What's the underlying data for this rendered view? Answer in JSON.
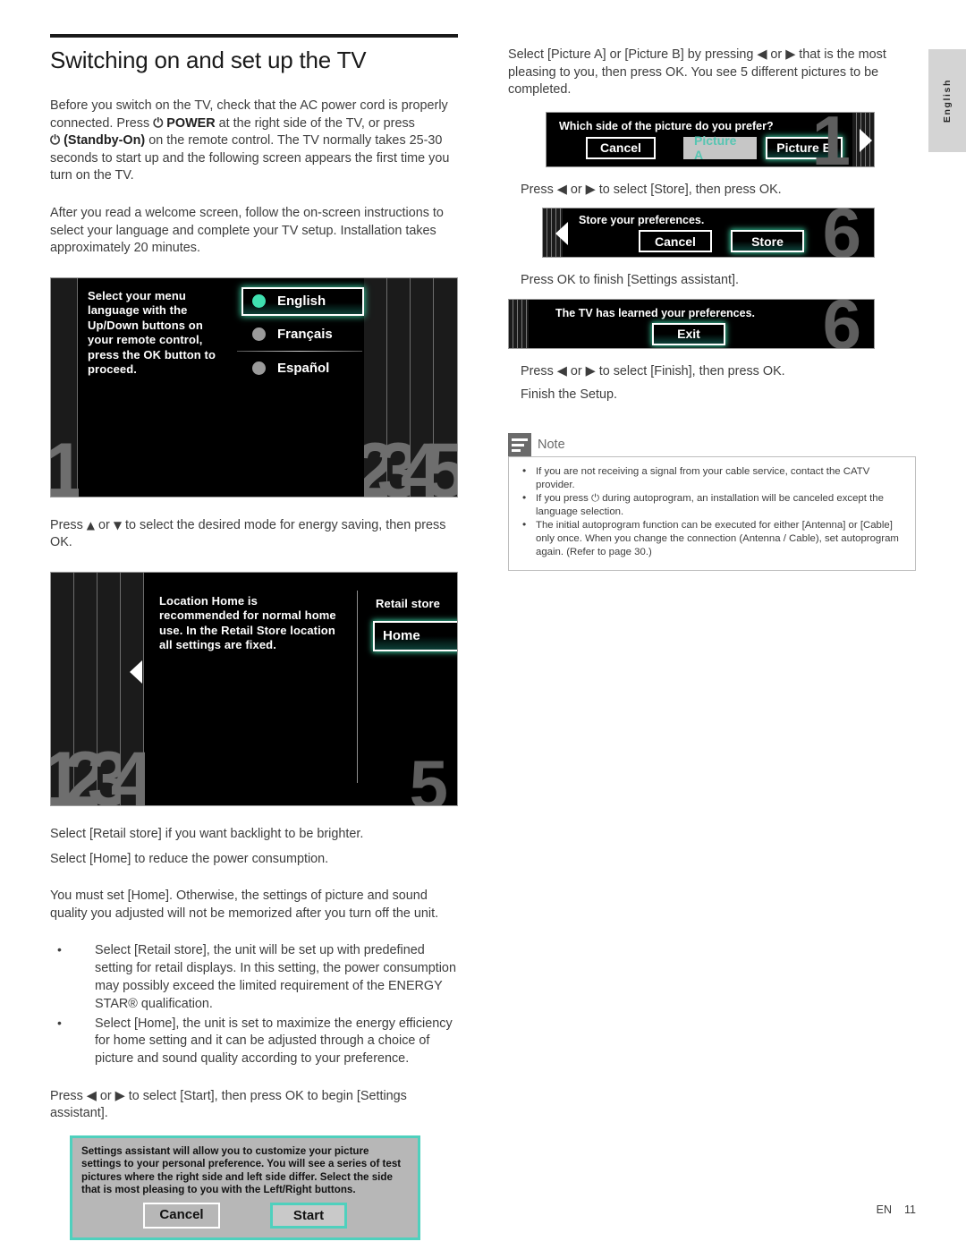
{
  "side_tab": {
    "label": "English"
  },
  "left": {
    "title": "Switching on and set up the TV",
    "para1_a": "Before you switch on the TV, check that the AC power cord is properly connected. Press ",
    "para1_power_symbol": "⏻",
    "para1_power": "POWER",
    "para1_b": " at the right side of the TV, or press ",
    "para1_standby_symbol": "⏻",
    "para1_standby": "(Standby-On)",
    "para1_c": " on the remote control. The TV normally takes 25-30 seconds to start up and the following screen appears the first time you turn on the TV.",
    "para2": "After you read a welcome screen, follow the on-screen instructions to select your language and complete your TV setup. Installation takes approximately 20 minutes.",
    "press_energy_a": "Press ",
    "press_energy_up": "▲",
    "press_energy_or": " or ",
    "press_energy_down": "▼",
    "press_energy_b": " to select the desired mode for energy saving, then press OK.",
    "sel_retail": "Select [Retail store] if you want backlight to be brighter.",
    "sel_home": "Select [Home] to reduce the power consumption.",
    "must_set": "You must set [Home]. Otherwise, the settings of picture and sound quality you adjusted will not be memorized after you turn off the unit.",
    "bullets": [
      "Select [Retail store], the unit will be set up with predefined setting for retail displays. In this setting, the power consumption may possibly exceed the limited requirement of the ENERGY STAR® qualification.",
      "Select [Home], the unit is set to maximize the energy efficiency for home setting and it can be adjusted through a choice of picture and sound quality according to your preference."
    ],
    "press_start": "Press ◀ or ▶ to select [Start], then press OK to begin [Settings assistant]."
  },
  "tv_language_screen": {
    "instruction": "Select your menu language with the Up/Down buttons on your remote control, press the OK button to proceed.",
    "options": [
      {
        "label": "English",
        "selected": true
      },
      {
        "label": "Français",
        "selected": false
      },
      {
        "label": "Español",
        "selected": false
      }
    ],
    "step_current": "1",
    "steps_remaining": [
      "2",
      "3",
      "4",
      "5"
    ]
  },
  "tv_location_screen": {
    "instruction": "Location Home is recommended for normal home use. In the Retail Store location all settings are fixed.",
    "option_title": "Retail store",
    "option_selected": "Home",
    "steps_done": [
      "1",
      "2",
      "3",
      "4"
    ],
    "step_next": "5"
  },
  "settings_assistant_dialog": {
    "text": "Settings assistant will allow you to customize your picture settings to your personal preference. You will see a series of test pictures where the right side and left side differ. Select the side that is most pleasing to you with the Left/Right buttons.",
    "cancel": "Cancel",
    "start": "Start"
  },
  "right": {
    "para1": "Select [Picture A] or [Picture B] by pressing ◀ or ▶ that is the most pleasing to you, then press OK. You see 5 different pictures to be completed.",
    "press_store": "Press ◀ or ▶ to select [Store], then press OK.",
    "press_ok_finish": "Press OK to finish [Settings assistant].",
    "press_finish": "Press ◀ or ▶ to select [Finish], then press OK.",
    "finish_setup": "Finish the Setup."
  },
  "banner_picture": {
    "title": "Which side of the picture do you prefer?",
    "cancel": "Cancel",
    "picture_a": "Picture A",
    "picture_b": "Picture B",
    "step": "1"
  },
  "banner_store": {
    "title": "Store your preferences.",
    "cancel": "Cancel",
    "store": "Store",
    "step": "6"
  },
  "banner_learned": {
    "title": "The TV has learned your preferences.",
    "exit": "Exit",
    "step": "6"
  },
  "note": {
    "heading": "Note",
    "items": [
      "If you are not receiving a signal from your cable service, contact the CATV provider.",
      "If you press ⏻ during autoprogram, an installation will be canceled except the language selection.",
      "The initial autoprogram function can be executed for either [Antenna] or [Cable] only once. When you change the connection (Antenna / Cable), set autoprogram again. (Refer to page 30.)"
    ]
  },
  "footer": {
    "lang": "EN",
    "page": "11"
  },
  "colors": {
    "accent_teal": "#3fe0b0",
    "dialog_border": "#4fd0bd",
    "screen_black": "#000000",
    "strip_gray": "#6e6e6e"
  }
}
